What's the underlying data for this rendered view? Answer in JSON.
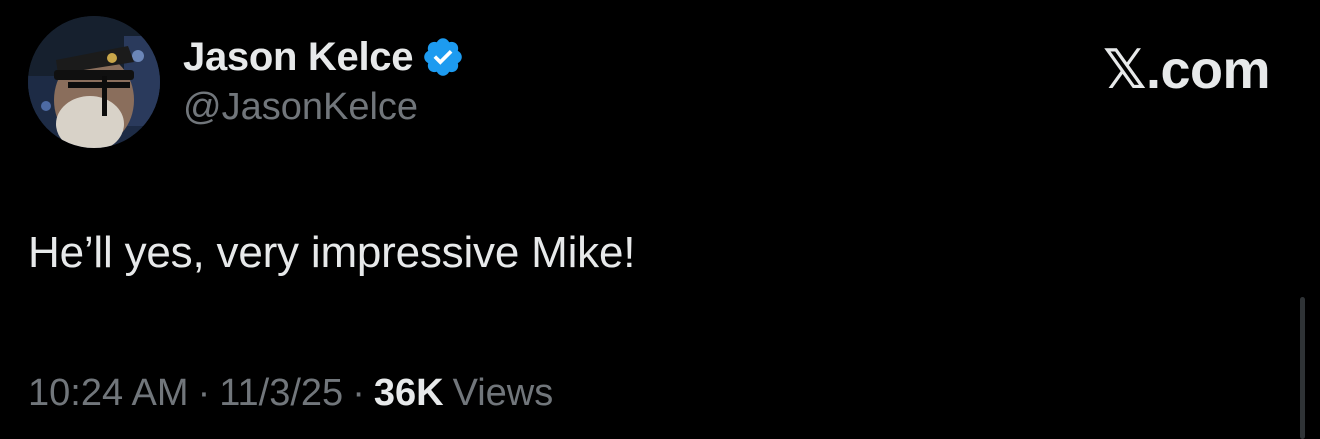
{
  "author": {
    "display_name": "Jason Kelce",
    "handle": "@JasonKelce",
    "verified": true
  },
  "site_label": "𝕏.com",
  "tweet": {
    "text": "He’ll yes, very impressive Mike!",
    "time": "10:24 AM",
    "separator": "·",
    "date": "11/3/25",
    "view_count": "36K",
    "views_label": "Views"
  },
  "colors": {
    "background": "#000000",
    "primary_text": "#e7e9ea",
    "secondary_text": "#71767b",
    "verified_blue": "#1d9bf0"
  },
  "icons": {
    "verified": "verified-badge-icon",
    "avatar": "avatar-photo"
  }
}
